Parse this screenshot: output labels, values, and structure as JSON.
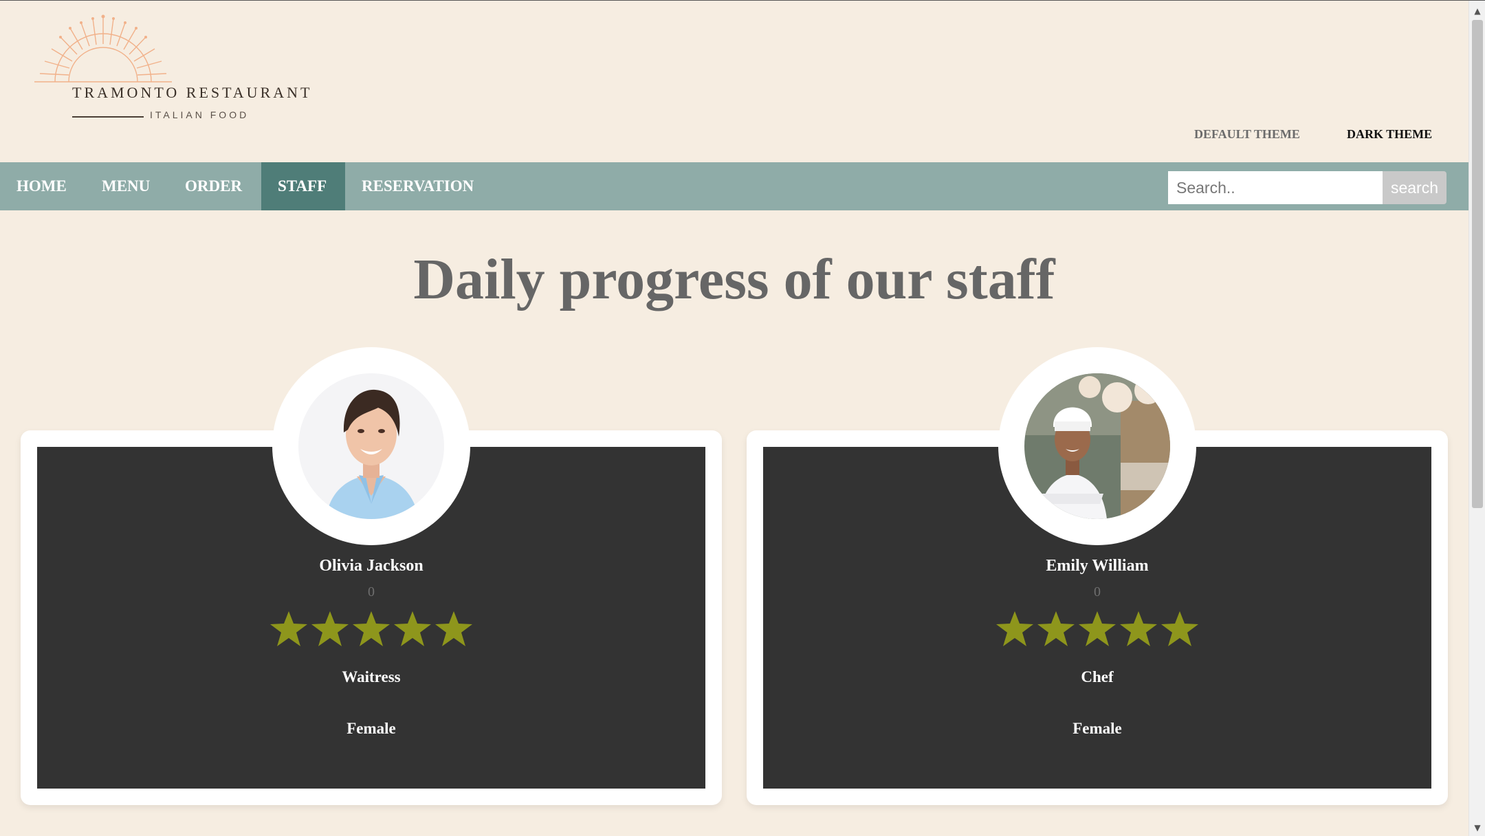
{
  "header": {
    "logo": {
      "name": "TRAMONTO RESTAURANT",
      "tagline": "ITALIAN FOOD",
      "icon": "sunburst-logo-icon"
    },
    "theme_default": "DEFAULT THEME",
    "theme_dark": "DARK THEME"
  },
  "nav": {
    "items": [
      {
        "label": "HOME"
      },
      {
        "label": "MENU"
      },
      {
        "label": "ORDER"
      },
      {
        "label": "STAFF",
        "active": true
      },
      {
        "label": "RESERVATION"
      }
    ],
    "search": {
      "placeholder": "Search..",
      "value": "",
      "button_label": "search"
    }
  },
  "main": {
    "title": "Daily progress of our staff",
    "staff": [
      {
        "name": "Olivia Jackson",
        "score": "0",
        "rating": 5,
        "role": "Waitress",
        "gender": "Female",
        "avatar": "woman-portrait-photo"
      },
      {
        "name": "Emily William",
        "score": "0",
        "rating": 5,
        "role": "Chef",
        "gender": "Female",
        "avatar": "chef-portrait-photo"
      }
    ]
  },
  "colors": {
    "background": "#f6ede1",
    "nav": "#8faca8",
    "nav_active": "#4f7d78",
    "card_inner": "#333333",
    "star": "#8e961c",
    "title": "#666666"
  }
}
